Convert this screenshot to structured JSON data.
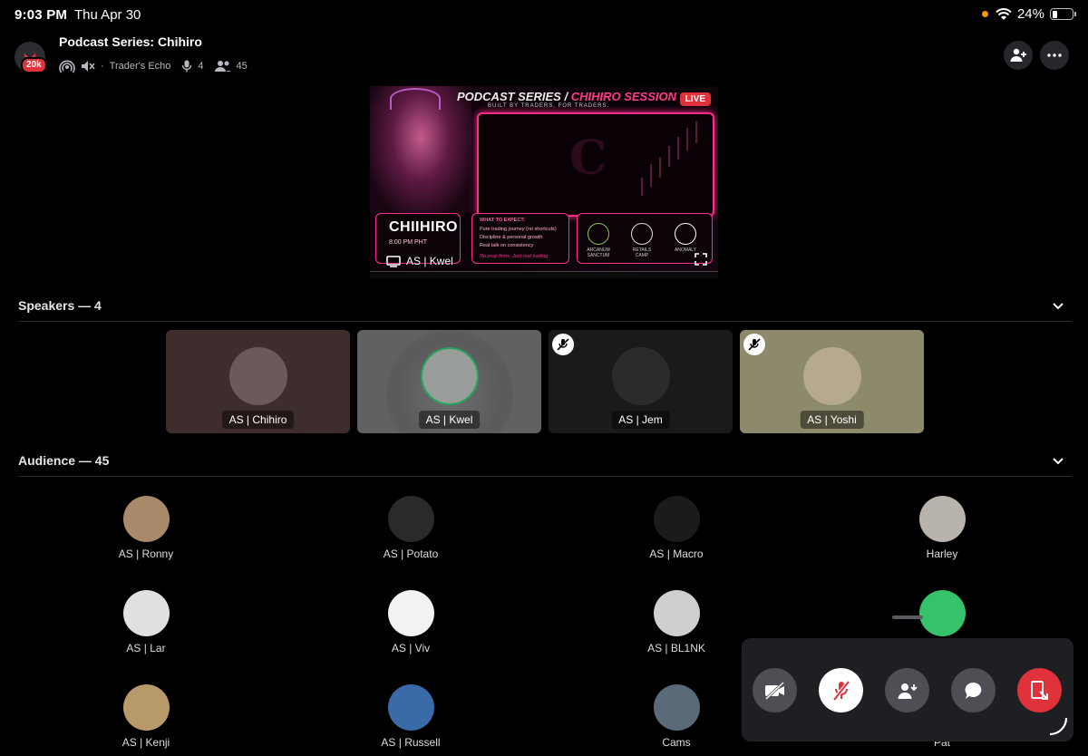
{
  "status_bar": {
    "time": "9:03 PM",
    "date": "Thu Apr 30",
    "battery": "24%",
    "battery_level": 0.24
  },
  "header": {
    "title": "Podcast Series: Chihiro",
    "server_badge": "20k",
    "channel_name": "Trader's Echo",
    "speaker_count": "4",
    "listener_count": "45",
    "bullet": "·"
  },
  "stream": {
    "heading_left": "PODCAST SERIES /",
    "heading_right": "CHIHIRO SESSION",
    "tagline": "BUILT BY TRADERS, FOR TRADERS.",
    "live_label": "LIVE",
    "host_name": "CHIIHIRO",
    "time": "8:00 PM PHT",
    "expect_title": "WHAT TO EXPECT:",
    "expect_items": [
      "Pure trading journey (no shortcuts)",
      "Discipline & personal growth",
      "Real talk on consistency"
    ],
    "expect_footer": "No prop firms. Just real trading",
    "logos": [
      "ARCANUM SANCTUM",
      "RETAILS CAMP",
      "ANOMALY"
    ],
    "streamer": "AS | Kwel"
  },
  "speakers_section": {
    "label": "Speakers — 4"
  },
  "speakers": [
    {
      "name": "AS | Chihiro",
      "muted": false,
      "bg": "#3e2d2d",
      "avatar": "#6b5a5a"
    },
    {
      "name": "AS | Kwel",
      "muted": false,
      "bg": "#616163",
      "avatar": "#9a9e9a",
      "speaking": true
    },
    {
      "name": "AS | Jem",
      "muted": true,
      "bg": "#1a1a1a",
      "avatar": "#2b2b2b"
    },
    {
      "name": "AS | Yoshi",
      "muted": true,
      "bg": "#8d8a6b",
      "avatar": "#b5aa90"
    }
  ],
  "audience_section": {
    "label": "Audience — 45"
  },
  "audience": [
    {
      "name": "AS | Ronny",
      "avatar": "#a88a6a"
    },
    {
      "name": "AS | Potato",
      "avatar": "#2a2a2a"
    },
    {
      "name": "AS | Macro",
      "avatar": "#1b1b1b"
    },
    {
      "name": "Harley",
      "avatar": "#b9b3ad"
    },
    {
      "name": "AS | Lar",
      "avatar": "#e0e0e0"
    },
    {
      "name": "AS | Viv",
      "avatar": "#f2f2f2"
    },
    {
      "name": "AS | BL1NK",
      "avatar": "#cfcfcf"
    },
    {
      "name": "",
      "avatar": "#35c26a"
    },
    {
      "name": "AS | Kenji",
      "avatar": "#b89a6a"
    },
    {
      "name": "AS | Russell",
      "avatar": "#3a6aa8"
    },
    {
      "name": "Cams",
      "avatar": "#5a6a78"
    },
    {
      "name": "Pat",
      "avatar": "#4a4a4a"
    }
  ],
  "controls": {
    "camera": "camera-off-icon",
    "mic": "mic-off-icon",
    "invite": "add-user-icon",
    "chat": "chat-icon",
    "leave": "leave-call-icon",
    "colors": {
      "neutral": "#4e4f54",
      "mic": "#ffffff",
      "leave": "#e0323a"
    }
  }
}
